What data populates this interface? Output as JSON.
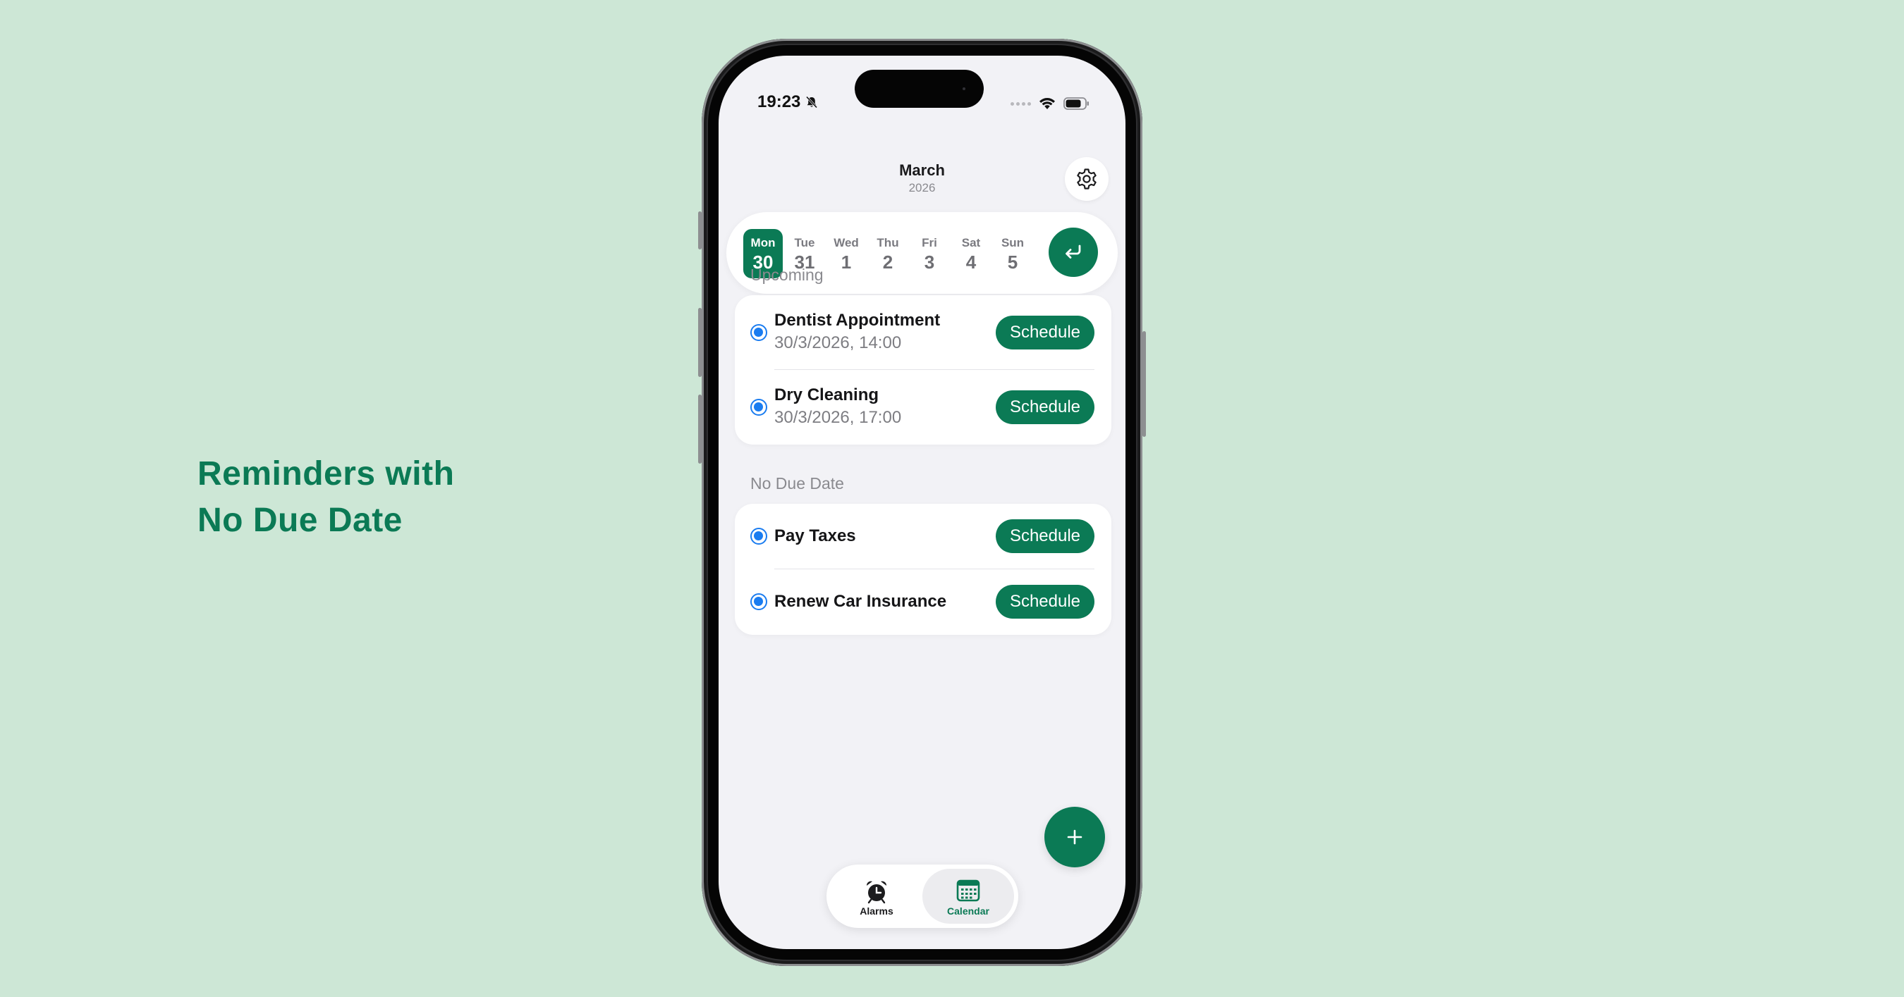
{
  "headline": {
    "line1": "Reminders with",
    "line2": "No Due Date"
  },
  "status_bar": {
    "time": "19:23"
  },
  "header": {
    "month": "March",
    "year": "2026"
  },
  "week": {
    "days": [
      {
        "name": "Mon",
        "num": "30",
        "selected": true
      },
      {
        "name": "Tue",
        "num": "31"
      },
      {
        "name": "Wed",
        "num": "1"
      },
      {
        "name": "Thu",
        "num": "2"
      },
      {
        "name": "Fri",
        "num": "3"
      },
      {
        "name": "Sat",
        "num": "4"
      },
      {
        "name": "Sun",
        "num": "5"
      }
    ]
  },
  "sections": {
    "upcoming": {
      "title": "Upcoming",
      "items": [
        {
          "title": "Dentist Appointment",
          "subtitle": "30/3/2026, 14:00",
          "button": "Schedule"
        },
        {
          "title": "Dry Cleaning",
          "subtitle": "30/3/2026, 17:00",
          "button": "Schedule"
        }
      ]
    },
    "no_due_date": {
      "title": "No Due Date",
      "items": [
        {
          "title": "Pay Taxes",
          "button": "Schedule"
        },
        {
          "title": "Renew Car Insurance",
          "button": "Schedule"
        }
      ]
    }
  },
  "tab_bar": {
    "tabs": [
      {
        "label": "Alarms",
        "icon": "alarm-clock-icon"
      },
      {
        "label": "Calendar",
        "icon": "calendar-icon",
        "active": true
      }
    ]
  },
  "colors": {
    "accent": "#0b7a55",
    "radio": "#1a7cf0",
    "background": "#cde7d6"
  }
}
